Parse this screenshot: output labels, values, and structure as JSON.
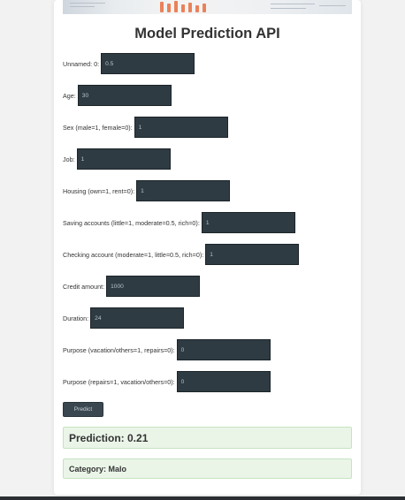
{
  "page": {
    "title": "Model Prediction API"
  },
  "form": {
    "fields": [
      {
        "label": "Unnamed: 0:",
        "value": "0.5"
      },
      {
        "label": "Age:",
        "value": "30"
      },
      {
        "label": "Sex (male=1, female=0):",
        "value": "1"
      },
      {
        "label": "Job:",
        "value": "1"
      },
      {
        "label": "Housing (own=1, rent=0):",
        "value": "1"
      },
      {
        "label": "Saving accounts (little=1, moderate=0.5, rich=0):",
        "value": "1"
      },
      {
        "label": "Checking account (moderate=1, little=0.5, rich=0):",
        "value": "1"
      },
      {
        "label": "Credit amount:",
        "value": "1000"
      },
      {
        "label": "Duration:",
        "value": "24"
      },
      {
        "label": "Purpose (vacation/others=1, repairs=0):",
        "value": "0"
      },
      {
        "label": "Purpose (repairs=1, vacation/others=0):",
        "value": "0"
      }
    ],
    "submit_label": "Predict"
  },
  "results": {
    "prediction": "Prediction: 0.21",
    "category": "Category: Malo"
  },
  "colors": {
    "input_bg": "#2f3b42",
    "result_bg": "#eaf5e8",
    "result_border": "#c6e3c2",
    "banner_accent": "#e9825a"
  }
}
